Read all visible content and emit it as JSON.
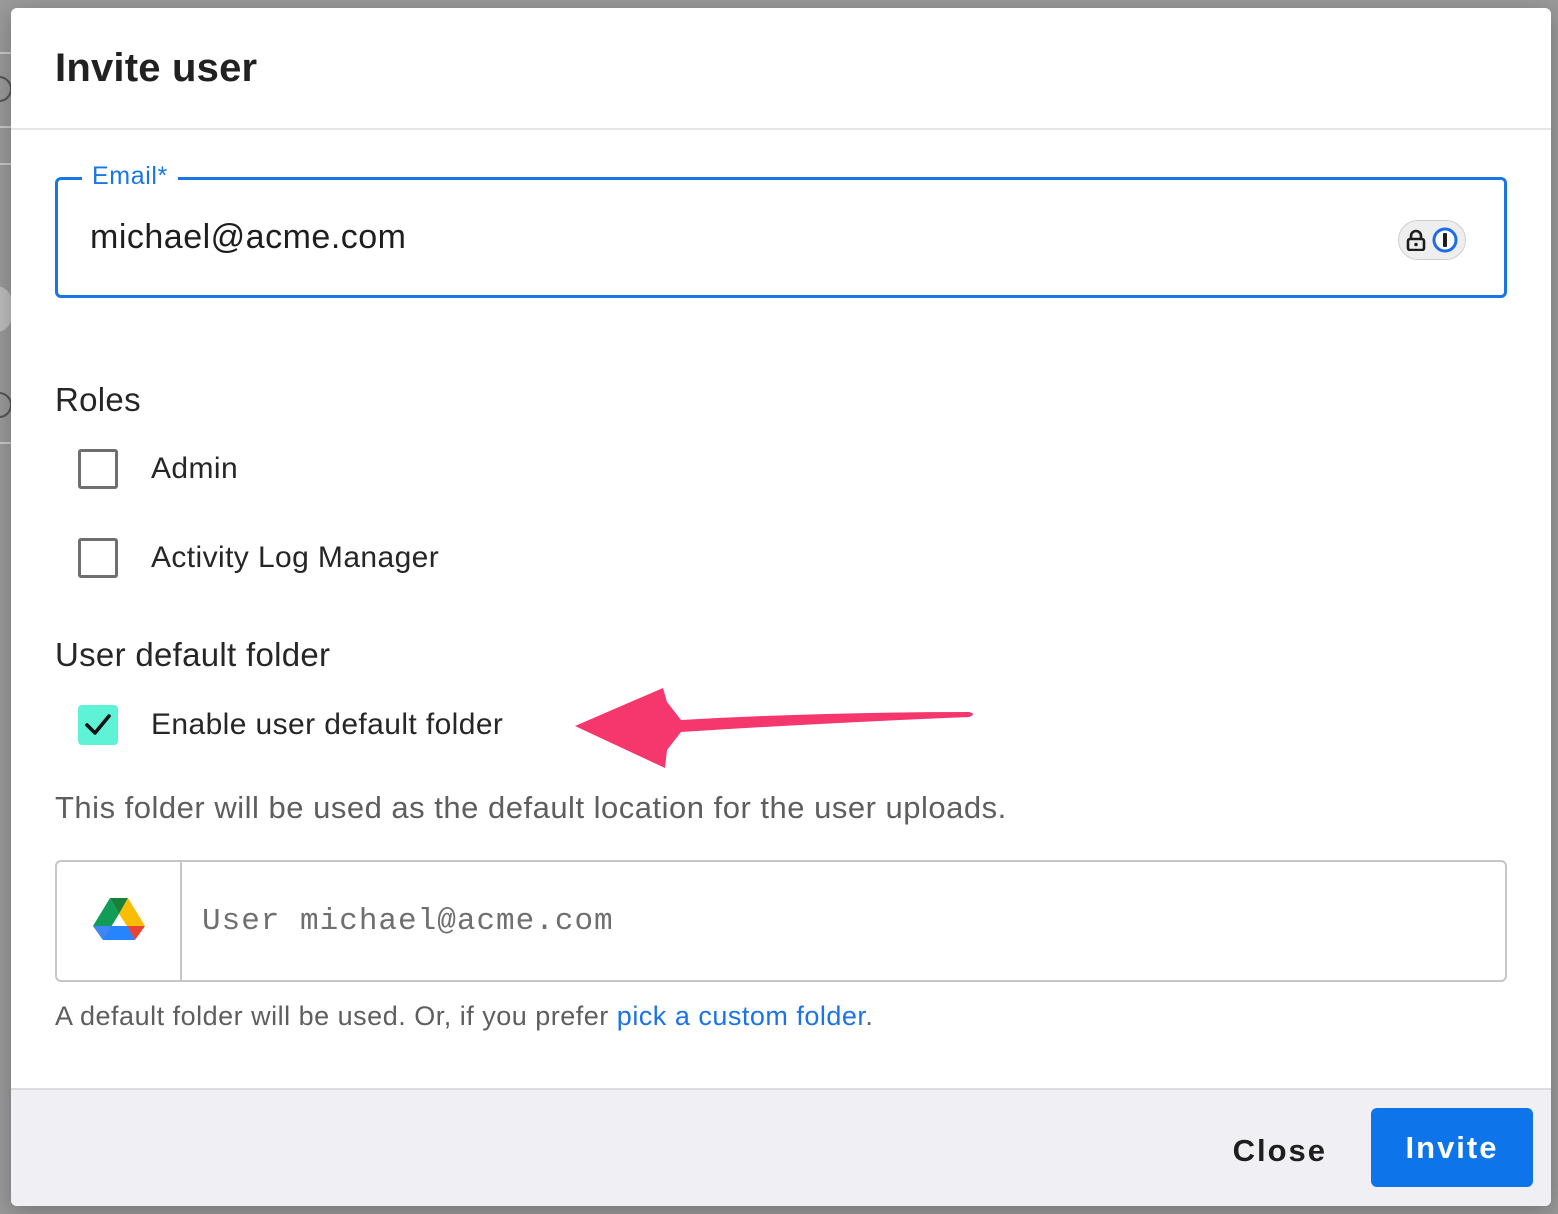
{
  "dialog": {
    "title": "Invite user"
  },
  "email": {
    "label": "Email*",
    "value": "michael@acme.com"
  },
  "roles": {
    "title": "Roles",
    "items": [
      {
        "label": "Admin",
        "checked": false
      },
      {
        "label": "Activity Log Manager",
        "checked": false
      }
    ]
  },
  "default_folder": {
    "title": "User default folder",
    "enable_label": "Enable user default folder",
    "enabled": true,
    "helper": "This folder will be used as the default location for the user uploads.",
    "folder_placeholder": "User michael@acme.com",
    "provider_icon": "google-drive-icon",
    "footnote_prefix": "A default folder will be used. Or, if you prefer ",
    "footnote_link": "pick a custom folder",
    "footnote_suffix": "."
  },
  "footer": {
    "close_label": "Close",
    "invite_label": "Invite"
  },
  "colors": {
    "accent": "#1976e6",
    "invite_button": "#0d74ea",
    "checkbox_checked": "#5ef2d6",
    "annotation_arrow": "#f5376e",
    "link": "#1a73e8"
  }
}
